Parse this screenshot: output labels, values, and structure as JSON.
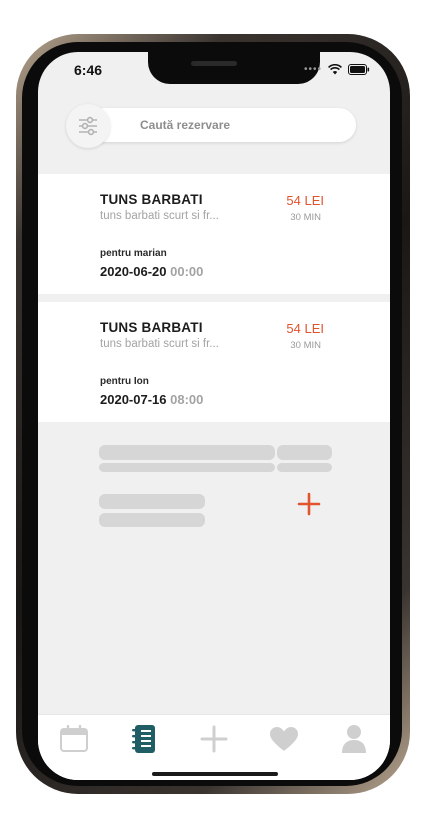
{
  "status_bar": {
    "time": "6:46",
    "icons": [
      "signal-dots-icon",
      "wifi-icon",
      "battery-icon"
    ]
  },
  "search": {
    "placeholder": "Caută rezervare",
    "filter_icon": "sliders-icon"
  },
  "bookings": [
    {
      "title": "TUNS BARBATI",
      "subtitle": "tuns barbati scurt si fr...",
      "price": "54 LEI",
      "duration": "30 MIN",
      "for_label": "pentru marian",
      "date": "2020-06-20",
      "time": "00:00"
    },
    {
      "title": "TUNS BARBATI",
      "subtitle": "tuns barbati scurt si fr...",
      "price": "54 LEI",
      "duration": "30 MIN",
      "for_label": "pentru Ion",
      "date": "2020-07-16",
      "time": "08:00"
    }
  ],
  "add_icon": "plus-icon",
  "tabbar": {
    "tabs": [
      {
        "icon": "calendar-icon",
        "active": false
      },
      {
        "icon": "notebook-icon",
        "active": true
      },
      {
        "icon": "plus-icon",
        "active": false
      },
      {
        "icon": "heart-icon",
        "active": false
      },
      {
        "icon": "user-icon",
        "active": false
      }
    ]
  },
  "colors": {
    "accent": "#e2542e",
    "active_tab": "#1f5e64",
    "inactive_tab": "#d0d0d0",
    "background": "#f0f0f0"
  }
}
